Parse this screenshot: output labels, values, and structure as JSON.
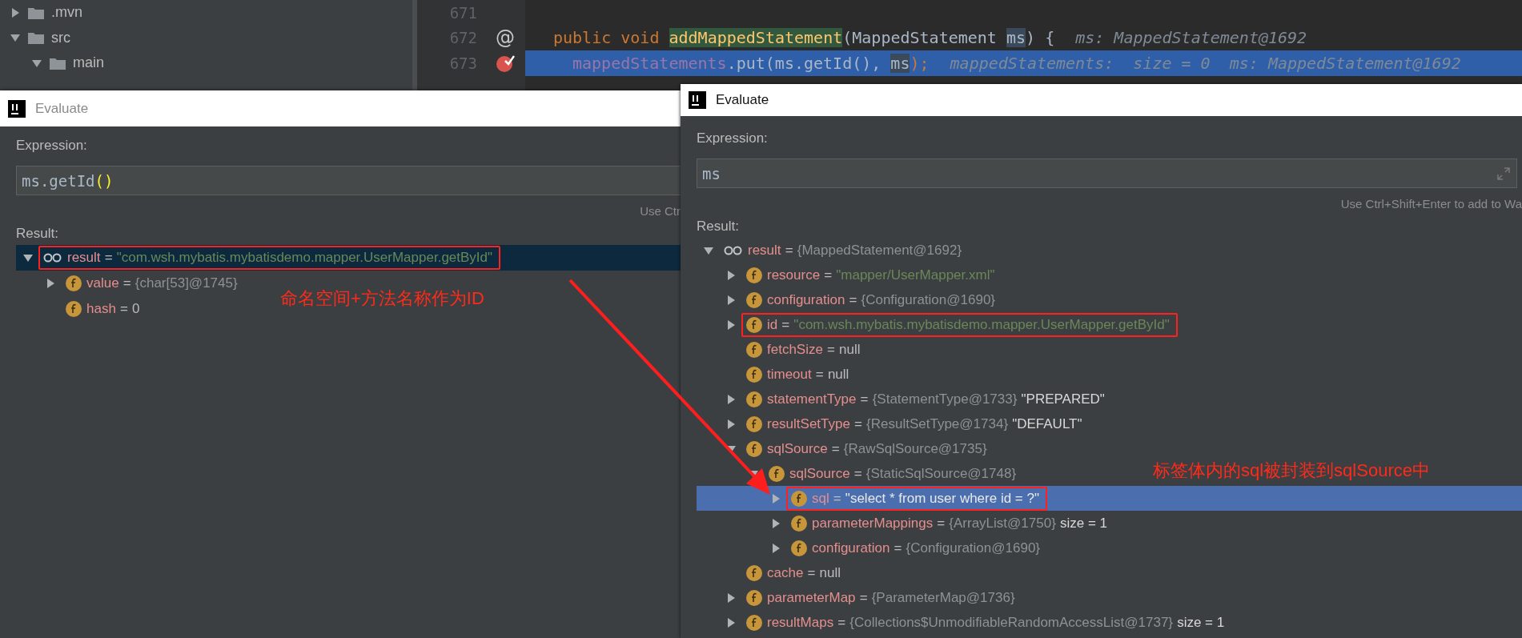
{
  "project_tree": [
    {
      "name": ".mvn",
      "expanded": false
    },
    {
      "name": "src",
      "expanded": true,
      "children": [
        {
          "name": "main",
          "expanded": true
        }
      ]
    }
  ],
  "editor": {
    "lines": [
      {
        "number": "671",
        "kind": "plain",
        "selected": false
      },
      {
        "number": "672",
        "kind": "override",
        "gutter_glyph": "@",
        "selected": false,
        "parts": [
          {
            "text": "public void ",
            "kind": "keyword"
          },
          {
            "text": "addMappedStatement",
            "kind": "method-decl"
          },
          {
            "text": "(MappedStatement ",
            "kind": "plain"
          },
          {
            "text": "ms",
            "kind": "usage"
          },
          {
            "text": ") {",
            "kind": "plain"
          },
          {
            "text": "ms: MappedStatement@1692",
            "kind": "hint"
          }
        ]
      },
      {
        "number": "673",
        "kind": "breakpoint",
        "selected": true,
        "parts": [
          {
            "text": "mappedStatements",
            "kind": "field"
          },
          {
            "text": ".put(ms.getId(), ",
            "kind": "plain"
          },
          {
            "text": "ms",
            "kind": "usage"
          },
          {
            "text": ");",
            "kind": "punct"
          },
          {
            "text": "mappedStatements:  size = 0  ms: MappedStatement@1692",
            "kind": "hint"
          }
        ]
      }
    ]
  },
  "dialogs": [
    {
      "title": "Evaluate",
      "active": false,
      "expression_label": "Expression:",
      "expression_parts": [
        {
          "text": "ms.getId",
          "kind": "plain"
        },
        {
          "text": "()",
          "kind": "matched-brace"
        }
      ],
      "hint": "Use Ctr",
      "result_label": "Result:",
      "note": "命名空间+方法名称作为ID",
      "result_tree": [
        {
          "kind": "watch",
          "parts": [
            {
              "text": "result",
              "kind": "name"
            },
            {
              "text": "=",
              "kind": "operator"
            },
            {
              "text": "\"com.wsh.mybatis.mybatisdemo.mapper.UserMapper.getById\"",
              "kind": "string"
            }
          ],
          "expanded": true,
          "selected": true,
          "boxed": true,
          "children": [
            {
              "kind": "field",
              "parts": [
                {
                  "text": "value",
                  "kind": "name"
                },
                {
                  "text": "=",
                  "kind": "operator"
                },
                {
                  "text": "{char[53]@1745}",
                  "kind": "object"
                }
              ],
              "expanded": false,
              "selected": false,
              "boxed": false
            },
            {
              "kind": "field",
              "parts": [
                {
                  "text": "hash",
                  "kind": "name"
                },
                {
                  "text": "=",
                  "kind": "operator"
                },
                {
                  "text": "0",
                  "kind": "plain"
                }
              ],
              "selected": false,
              "boxed": false
            }
          ]
        }
      ]
    },
    {
      "title": "Evaluate",
      "active": true,
      "expression_label": "Expression:",
      "expression_parts": [
        {
          "text": "ms",
          "kind": "plain"
        }
      ],
      "hint": "Use Ctrl+Shift+Enter to add to Wa",
      "result_label": "Result:",
      "note": "标签体内的sql被封装到sqlSource中",
      "result_tree": [
        {
          "kind": "watch",
          "parts": [
            {
              "text": "result",
              "kind": "name"
            },
            {
              "text": "=",
              "kind": "operator"
            },
            {
              "text": "{MappedStatement@1692}",
              "kind": "object"
            }
          ],
          "expanded": true,
          "selected": false,
          "boxed": false,
          "children": [
            {
              "kind": "field",
              "parts": [
                {
                  "text": "resource",
                  "kind": "name"
                },
                {
                  "text": "=",
                  "kind": "operator"
                },
                {
                  "text": "\"mapper/UserMapper.xml\"",
                  "kind": "string"
                }
              ],
              "expanded": false,
              "selected": false,
              "boxed": false
            },
            {
              "kind": "field",
              "parts": [
                {
                  "text": "configuration",
                  "kind": "name"
                },
                {
                  "text": "=",
                  "kind": "operator"
                },
                {
                  "text": "{Configuration@1690}",
                  "kind": "object"
                }
              ],
              "expanded": false,
              "selected": false,
              "boxed": false
            },
            {
              "kind": "field",
              "parts": [
                {
                  "text": "id",
                  "kind": "name"
                },
                {
                  "text": "=",
                  "kind": "operator"
                },
                {
                  "text": "\"com.wsh.mybatis.mybatisdemo.mapper.UserMapper.getById\"",
                  "kind": "string"
                }
              ],
              "expanded": false,
              "selected": false,
              "boxed": true
            },
            {
              "kind": "field",
              "parts": [
                {
                  "text": "fetchSize",
                  "kind": "name"
                },
                {
                  "text": "=",
                  "kind": "operator"
                },
                {
                  "text": "null",
                  "kind": "plain"
                }
              ],
              "selected": false,
              "boxed": false
            },
            {
              "kind": "field",
              "parts": [
                {
                  "text": "timeout",
                  "kind": "name"
                },
                {
                  "text": "=",
                  "kind": "operator"
                },
                {
                  "text": "null",
                  "kind": "plain"
                }
              ],
              "selected": false,
              "boxed": false
            },
            {
              "kind": "field",
              "parts": [
                {
                  "text": "statementType",
                  "kind": "name"
                },
                {
                  "text": "=",
                  "kind": "operator"
                },
                {
                  "text": "{StatementType@1733}",
                  "kind": "object"
                },
                {
                  "text": "\"PREPARED\"",
                  "kind": "extra"
                }
              ],
              "expanded": false,
              "selected": false,
              "boxed": false
            },
            {
              "kind": "field",
              "parts": [
                {
                  "text": "resultSetType",
                  "kind": "name"
                },
                {
                  "text": "=",
                  "kind": "operator"
                },
                {
                  "text": "{ResultSetType@1734}",
                  "kind": "object"
                },
                {
                  "text": "\"DEFAULT\"",
                  "kind": "extra"
                }
              ],
              "expanded": false,
              "selected": false,
              "boxed": false
            },
            {
              "kind": "field",
              "parts": [
                {
                  "text": "sqlSource",
                  "kind": "name"
                },
                {
                  "text": "=",
                  "kind": "operator"
                },
                {
                  "text": "{RawSqlSource@1735}",
                  "kind": "object"
                }
              ],
              "expanded": true,
              "selected": false,
              "boxed": false,
              "children": [
                {
                  "kind": "field",
                  "parts": [
                    {
                      "text": "sqlSource",
                      "kind": "name"
                    },
                    {
                      "text": "=",
                      "kind": "operator"
                    },
                    {
                      "text": "{StaticSqlSource@1748}",
                      "kind": "object"
                    }
                  ],
                  "expanded": true,
                  "selected": false,
                  "boxed": false,
                  "children": [
                    {
                      "kind": "field",
                      "parts": [
                        {
                          "text": "sql",
                          "kind": "name"
                        },
                        {
                          "text": "=",
                          "kind": "operator"
                        },
                        {
                          "text": "\"select * from user where id = ?\"",
                          "kind": "string"
                        }
                      ],
                      "expanded": false,
                      "selected": true,
                      "boxed": true
                    },
                    {
                      "kind": "field",
                      "parts": [
                        {
                          "text": "parameterMappings",
                          "kind": "name"
                        },
                        {
                          "text": "=",
                          "kind": "operator"
                        },
                        {
                          "text": "{ArrayList@1750}",
                          "kind": "object"
                        },
                        {
                          "text": "size = 1",
                          "kind": "extra"
                        }
                      ],
                      "expanded": false,
                      "selected": false,
                      "boxed": false
                    },
                    {
                      "kind": "field",
                      "parts": [
                        {
                          "text": "configuration",
                          "kind": "name"
                        },
                        {
                          "text": "=",
                          "kind": "operator"
                        },
                        {
                          "text": "{Configuration@1690}",
                          "kind": "object"
                        }
                      ],
                      "expanded": false,
                      "selected": false,
                      "boxed": false
                    }
                  ]
                }
              ]
            },
            {
              "kind": "field",
              "parts": [
                {
                  "text": "cache",
                  "kind": "name"
                },
                {
                  "text": "=",
                  "kind": "operator"
                },
                {
                  "text": "null",
                  "kind": "plain"
                }
              ],
              "selected": false,
              "boxed": false
            },
            {
              "kind": "field",
              "parts": [
                {
                  "text": "parameterMap",
                  "kind": "name"
                },
                {
                  "text": "=",
                  "kind": "operator"
                },
                {
                  "text": "{ParameterMap@1736}",
                  "kind": "object"
                }
              ],
              "expanded": false,
              "selected": false,
              "boxed": false
            },
            {
              "kind": "field",
              "parts": [
                {
                  "text": "resultMaps",
                  "kind": "name"
                },
                {
                  "text": "=",
                  "kind": "operator"
                },
                {
                  "text": "{Collections$UnmodifiableRandomAccessList@1737}",
                  "kind": "object"
                },
                {
                  "text": "size = 1",
                  "kind": "extra"
                }
              ],
              "expanded": false,
              "selected": false,
              "boxed": false
            }
          ]
        }
      ]
    }
  ]
}
